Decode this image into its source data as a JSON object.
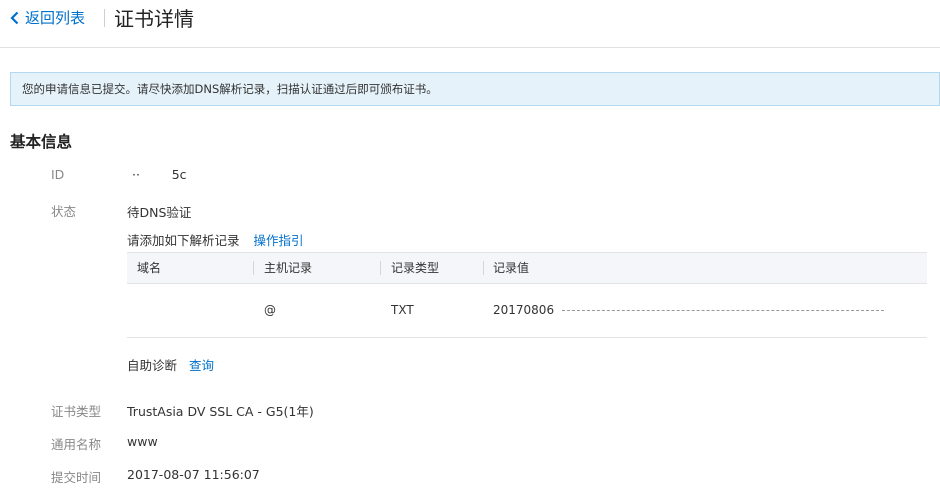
{
  "header": {
    "back_label": "返回列表",
    "title": "证书详情"
  },
  "notice": {
    "text": "您的申请信息已提交。请尽快添加DNS解析记录，扫描认证通过后即可颁布证书。"
  },
  "basic_info": {
    "section_title": "基本信息",
    "id": {
      "label": "ID",
      "value": "··        5c"
    },
    "status": {
      "label": "状态",
      "value": "待DNS验证",
      "hint": "请添加如下解析记录",
      "guide_link": "操作指引"
    },
    "dns_table": {
      "columns": [
        "域名",
        "主机记录",
        "记录类型",
        "记录值"
      ],
      "rows": [
        {
          "domain": "",
          "host": "@",
          "type": "TXT",
          "value": "20170806"
        }
      ]
    },
    "self_diagnosis": {
      "label": "自助诊断",
      "link": "查询"
    },
    "cert_type": {
      "label": "证书类型",
      "value": "TrustAsia DV SSL CA - G5(1年)"
    },
    "common_name": {
      "label": "通用名称",
      "value": "www"
    },
    "submit_time": {
      "label": "提交时间",
      "value": "2017-08-07 11:56:07"
    }
  },
  "colors": {
    "accent": "#0070cc",
    "notice_bg": "#e5f2fa",
    "table_head_bg": "#f5f6fa"
  }
}
